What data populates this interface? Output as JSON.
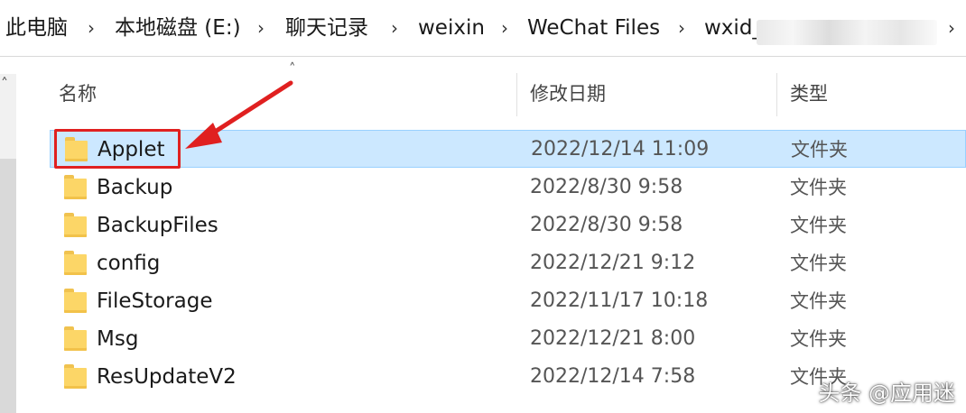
{
  "breadcrumb": {
    "items": [
      "此电脑",
      "本地磁盘 (E:)",
      "聊天记录",
      "weixin",
      "WeChat Files",
      "wxid_"
    ]
  },
  "columns": {
    "name": "名称",
    "modified": "修改日期",
    "type": "类型"
  },
  "files": [
    {
      "name": "Applet",
      "modified": "2022/12/14 11:09",
      "type": "文件夹",
      "selected": true
    },
    {
      "name": "Backup",
      "modified": "2022/8/30 9:58",
      "type": "文件夹"
    },
    {
      "name": "BackupFiles",
      "modified": "2022/8/30 9:58",
      "type": "文件夹"
    },
    {
      "name": "config",
      "modified": "2022/12/21 9:12",
      "type": "文件夹"
    },
    {
      "name": "FileStorage",
      "modified": "2022/11/17 10:18",
      "type": "文件夹"
    },
    {
      "name": "Msg",
      "modified": "2022/12/21 8:00",
      "type": "文件夹"
    },
    {
      "name": "ResUpdateV2",
      "modified": "2022/12/14 7:58",
      "type": "文件夹"
    }
  ],
  "watermark": "头条 @应用迷",
  "colors": {
    "selection": "#cce8ff",
    "annotation": "#e02020",
    "folder": "#fcd667"
  },
  "icons": {
    "folder": "folder-icon",
    "sort": "chevron-up-icon",
    "separator": "chevron-right-icon"
  }
}
